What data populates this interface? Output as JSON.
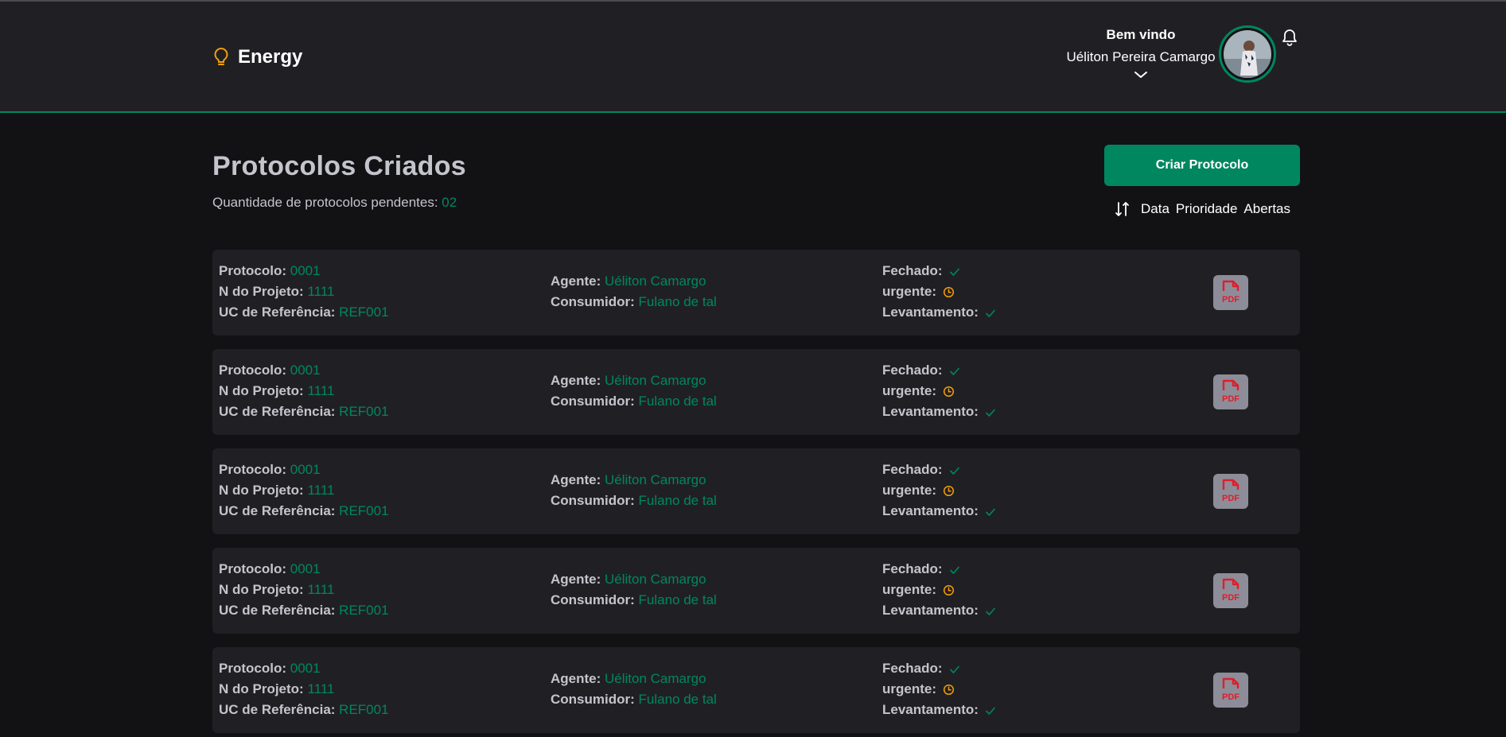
{
  "brand": {
    "name": "Energy",
    "icon": "lightbulb-icon",
    "icon_color": "#f59e0b"
  },
  "header": {
    "welcome": "Bem vindo",
    "user_name": "Uéliton Pereira Camargo",
    "dropdown_icon": "chevron-down-icon",
    "notification_icon": "bell-icon"
  },
  "page": {
    "title": "Protocolos Criados",
    "pending_label": "Quantidade de protocolos pendentes:",
    "pending_count": "02",
    "create_button": "Criar Protocolo",
    "sort_icon": "sort-arrows-icon",
    "sort_options": [
      "Data",
      "Prioridade",
      "Abertas"
    ]
  },
  "labels": {
    "protocolo": "Protocolo:",
    "projeto": "N do Projeto:",
    "uc": "UC de Referência:",
    "agente": "Agente:",
    "consumidor": "Consumidor:",
    "fechado": "Fechado:",
    "urgente": "urgente:",
    "levantamento": "Levantamento:",
    "pdf": "PDF"
  },
  "protocols": [
    {
      "protocolo": "0001",
      "projeto": "1111",
      "uc": "REF001",
      "agente": "Uéliton Camargo",
      "consumidor": "Fulano de tal",
      "fechado": "check-icon",
      "urgente": "clock-icon",
      "levantamento": "check-icon"
    },
    {
      "protocolo": "0001",
      "projeto": "1111",
      "uc": "REF001",
      "agente": "Uéliton Camargo",
      "consumidor": "Fulano de tal",
      "fechado": "check-icon",
      "urgente": "clock-icon",
      "levantamento": "check-icon"
    },
    {
      "protocolo": "0001",
      "projeto": "1111",
      "uc": "REF001",
      "agente": "Uéliton Camargo",
      "consumidor": "Fulano de tal",
      "fechado": "check-icon",
      "urgente": "clock-icon",
      "levantamento": "check-icon"
    },
    {
      "protocolo": "0001",
      "projeto": "1111",
      "uc": "REF001",
      "agente": "Uéliton Camargo",
      "consumidor": "Fulano de tal",
      "fechado": "check-icon",
      "urgente": "clock-icon",
      "levantamento": "check-icon"
    },
    {
      "protocolo": "0001",
      "projeto": "1111",
      "uc": "REF001",
      "agente": "Uéliton Camargo",
      "consumidor": "Fulano de tal",
      "fechado": "check-icon",
      "urgente": "clock-icon",
      "levantamento": "check-icon"
    }
  ],
  "colors": {
    "accent": "#00875f",
    "warning": "#f59e0b",
    "pdf_red": "#e11d2a",
    "card_bg": "#202024",
    "page_bg": "#121214"
  }
}
